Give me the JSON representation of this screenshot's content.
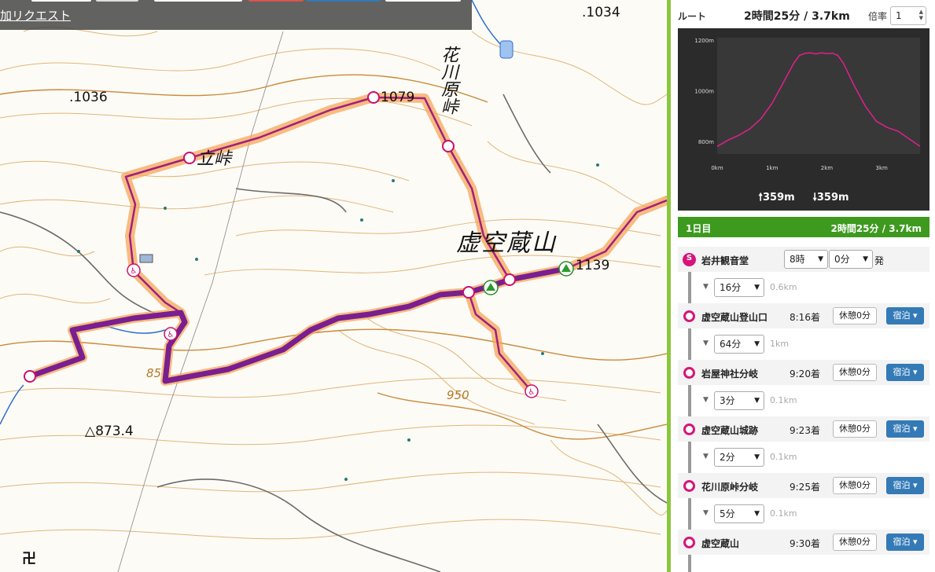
{
  "toolbar": {
    "add_request_label": "加リクエスト"
  },
  "map": {
    "labels": {
      "elev_1034": ".1034",
      "elev_1036": ".1036",
      "elev_1079": "1079",
      "elev_1139": "1139",
      "elev_873": "△873.4",
      "contour_850": "85",
      "contour_950": "950",
      "mountain_name": "虚空蔵山",
      "pass_hanakawara": "花川原峠",
      "pass_tachi": "立峠",
      "temple_symbol": "卍"
    }
  },
  "route": {
    "label": "ルート",
    "summary": "2時間25分 / 3.7km",
    "scale_label": "倍率",
    "scale_value": "1"
  },
  "profile": {
    "ascent": "359m",
    "descent": "359m"
  },
  "chart_data": {
    "type": "line",
    "title": "",
    "xlabel": "",
    "ylabel": "",
    "x_ticks": [
      "0km",
      "1km",
      "2km",
      "3km"
    ],
    "y_ticks": [
      "800m",
      "1000m",
      "1200m"
    ],
    "xlim": [
      0,
      3.7
    ],
    "ylim": [
      750,
      1210
    ],
    "grid": false,
    "series": [
      {
        "color": "#e0208c",
        "x": [
          0,
          0.2,
          0.4,
          0.6,
          0.8,
          1.0,
          1.2,
          1.4,
          1.5,
          1.6,
          1.7,
          1.8,
          1.9,
          2.0,
          2.1,
          2.2,
          2.3,
          2.5,
          2.7,
          2.9,
          3.1,
          3.3,
          3.5,
          3.7
        ],
        "y": [
          780,
          805,
          825,
          850,
          890,
          950,
          1030,
          1110,
          1140,
          1148,
          1150,
          1146,
          1150,
          1147,
          1149,
          1140,
          1110,
          1020,
          940,
          880,
          855,
          840,
          810,
          780
        ]
      }
    ]
  },
  "day": {
    "label": "1日目",
    "total": "2時間25分 / 3.7km"
  },
  "start": {
    "badge": "S",
    "name": "岩井観音堂",
    "hour": "8時",
    "minute": "0分",
    "depart": "発"
  },
  "segments": [
    {
      "time": "16分",
      "dist": "0.6km"
    },
    {
      "time": "64分",
      "dist": "1km"
    },
    {
      "time": "3分",
      "dist": "0.1km"
    },
    {
      "time": "2分",
      "dist": "0.1km"
    },
    {
      "time": "5分",
      "dist": "0.1km"
    }
  ],
  "stops": [
    {
      "name": "虚空蔵山登山口",
      "arrive": "8:16着",
      "rest": "休憩0分",
      "stay": "宿泊"
    },
    {
      "name": "岩屋神社分岐",
      "arrive": "9:20着",
      "rest": "休憩0分",
      "stay": "宿泊"
    },
    {
      "name": "虚空蔵山城跡",
      "arrive": "9:23着",
      "rest": "休憩0分",
      "stay": "宿泊"
    },
    {
      "name": "花川原峠分岐",
      "arrive": "9:25着",
      "rest": "休憩0分",
      "stay": "宿泊"
    },
    {
      "name": "虚空蔵山",
      "arrive": "9:30着",
      "rest": "休憩0分",
      "stay": "宿泊"
    }
  ],
  "colors": {
    "route_line": "#7a1f8f",
    "route_thin": "#a0207a",
    "accent_green": "#3d9a1f",
    "sidebar_border": "#8cc63f",
    "stay_button": "#337ab7",
    "waypoint": "#d6157a"
  }
}
